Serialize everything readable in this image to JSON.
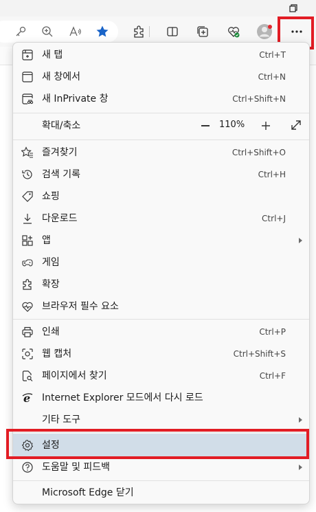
{
  "menu": {
    "new_tab": {
      "label": "새 탭",
      "shortcut": "Ctrl+T"
    },
    "new_window": {
      "label": "새 창에서",
      "shortcut": "Ctrl+N"
    },
    "new_inprivate": {
      "label": "새 InPrivate 창",
      "shortcut": "Ctrl+Shift+N"
    },
    "zoom": {
      "label": "확대/축소",
      "value": "110%"
    },
    "favorites": {
      "label": "즐겨찾기",
      "shortcut": "Ctrl+Shift+O"
    },
    "history": {
      "label": "검색 기록",
      "shortcut": "Ctrl+H"
    },
    "shopping": {
      "label": "쇼핑"
    },
    "downloads": {
      "label": "다운로드",
      "shortcut": "Ctrl+J"
    },
    "apps": {
      "label": "앱"
    },
    "games": {
      "label": "게임"
    },
    "extensions": {
      "label": "확장"
    },
    "browser_essentials": {
      "label": "브라우저 필수 요소"
    },
    "print": {
      "label": "인쇄",
      "shortcut": "Ctrl+P"
    },
    "web_capture": {
      "label": "웹 캡처",
      "shortcut": "Ctrl+Shift+S"
    },
    "find_on_page": {
      "label": "페이지에서 찾기",
      "shortcut": "Ctrl+F"
    },
    "ie_mode": {
      "label": "Internet Explorer 모드에서 다시 로드"
    },
    "more_tools": {
      "label": "기타 도구"
    },
    "settings": {
      "label": "설정"
    },
    "help_feedback": {
      "label": "도움말 및 피드백"
    },
    "close_edge": {
      "label": "Microsoft Edge 닫기"
    }
  },
  "colors": {
    "highlight": "#e21c24",
    "active_row": "#d1dde8",
    "favorite_star": "#1a64c8"
  }
}
